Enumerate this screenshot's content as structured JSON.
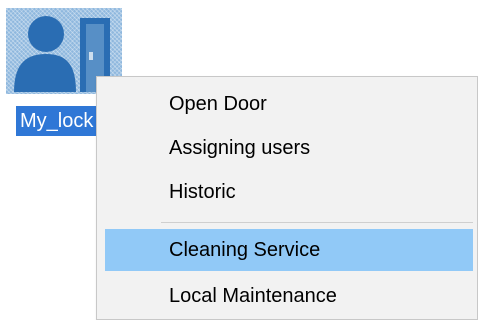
{
  "desktop_icon": {
    "label": "My_lock",
    "icon": "user-door-icon",
    "selected": true
  },
  "context_menu": {
    "items": [
      {
        "label": "Open Door"
      },
      {
        "label": "Assigning users"
      },
      {
        "label": "Historic"
      },
      {
        "label": "Cleaning Service",
        "highlighted": true
      },
      {
        "label": "Local Maintenance"
      }
    ]
  },
  "colors": {
    "selection": "#2f77d6",
    "icon_tile": "#8fb8de",
    "menu_background": "#f2f2f2",
    "menu_highlight": "#91c9f7",
    "icon_glyph": "#2a6db3"
  }
}
